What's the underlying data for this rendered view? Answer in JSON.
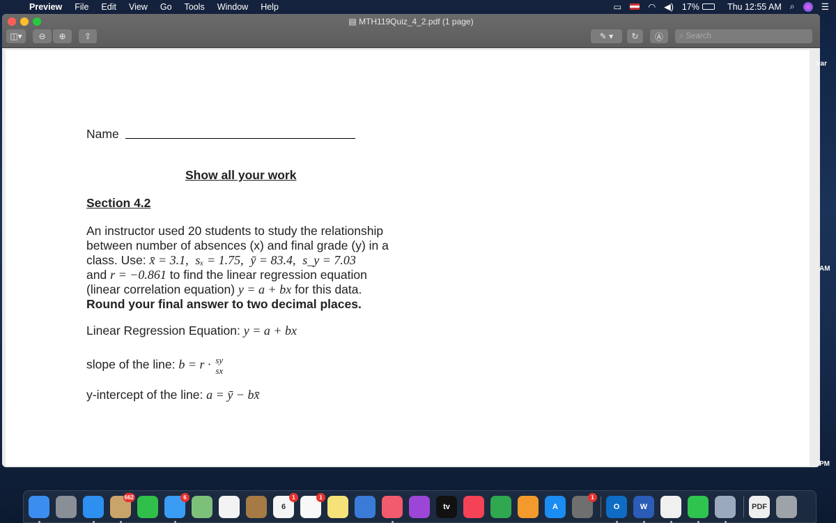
{
  "menubar": {
    "app": "Preview",
    "items": [
      "File",
      "Edit",
      "View",
      "Go",
      "Tools",
      "Window",
      "Help"
    ],
    "battery": "17%",
    "clock": "Thu 12:55 AM"
  },
  "window": {
    "title": "MTH119Quiz_4_2.pdf (1 page)",
    "search_placeholder": "Search"
  },
  "document": {
    "name_label": "Name",
    "instruction": "Show all your work",
    "section": "Section 4.2",
    "problem_lines": [
      "An instructor used 20 students to study the relationship",
      "between number of absences (x) and final grade (y) in a",
      "class. Use: ",
      "and ",
      "to find the linear regression equation",
      "(linear correlation equation) ",
      "for this data."
    ],
    "stats": {
      "xbar": "x̄ = 3.1,",
      "sx": "sₓ = 1.75,",
      "ybar": "ȳ = 83.4,",
      "sy": "s_y = 7.03",
      "r": "r = −0.861",
      "eq": "y = a + bx"
    },
    "round_note": "Round your final answer to two decimal places.",
    "lre_label": "Linear Regression Equation: ",
    "lre_eq": "y = a + bx",
    "slope_label": "slope of the line: ",
    "slope_eq": "b = r ·",
    "slope_num": "sy",
    "slope_den": "sx",
    "intercept_label": "y-intercept of the line: ",
    "intercept_eq": "a = ȳ − bx̄"
  },
  "side_peek": [
    "var",
    "AM",
    "PM"
  ],
  "dock": [
    {
      "name": "finder",
      "color": "#3b8ef0"
    },
    {
      "name": "launchpad",
      "color": "#8a8f97"
    },
    {
      "name": "safari",
      "color": "#2d8ff0"
    },
    {
      "name": "mail",
      "color": "#c8a46a",
      "badge": "662"
    },
    {
      "name": "facetime",
      "color": "#2fbf4a"
    },
    {
      "name": "messages",
      "color": "#3a9cf5",
      "badge": "6"
    },
    {
      "name": "maps",
      "color": "#7dc07a"
    },
    {
      "name": "photos",
      "color": "#f3f3f3"
    },
    {
      "name": "contacts",
      "color": "#a67a45"
    },
    {
      "name": "calendar",
      "color": "#f5f5f5",
      "badge": "1",
      "label": "6"
    },
    {
      "name": "reminders",
      "color": "#f8f8f8",
      "badge": "1"
    },
    {
      "name": "notes",
      "color": "#f7e27a"
    },
    {
      "name": "keynote",
      "color": "#3b7bd8"
    },
    {
      "name": "music",
      "color": "#f25a6e"
    },
    {
      "name": "podcasts",
      "color": "#9b46d6"
    },
    {
      "name": "tv",
      "color": "#111111",
      "label": "tv"
    },
    {
      "name": "news",
      "color": "#f44256"
    },
    {
      "name": "numbers",
      "color": "#2fa84f"
    },
    {
      "name": "pages",
      "color": "#f39a2c"
    },
    {
      "name": "app-store",
      "color": "#1b8cf2",
      "label": "A"
    },
    {
      "name": "system-preferences",
      "color": "#6f6f6f",
      "badge": "1"
    },
    {
      "name": "outlook",
      "color": "#0f6cc4",
      "label": "O"
    },
    {
      "name": "word",
      "color": "#2b5cb8",
      "label": "W"
    },
    {
      "name": "infuse",
      "color": "#f0f0f0"
    },
    {
      "name": "whatsapp",
      "color": "#2fc34f"
    },
    {
      "name": "preview",
      "color": "#9aa9bd"
    },
    {
      "name": "pdf-document",
      "color": "#eeeeee",
      "label": "PDF"
    },
    {
      "name": "trash",
      "color": "#9da3a8"
    }
  ]
}
